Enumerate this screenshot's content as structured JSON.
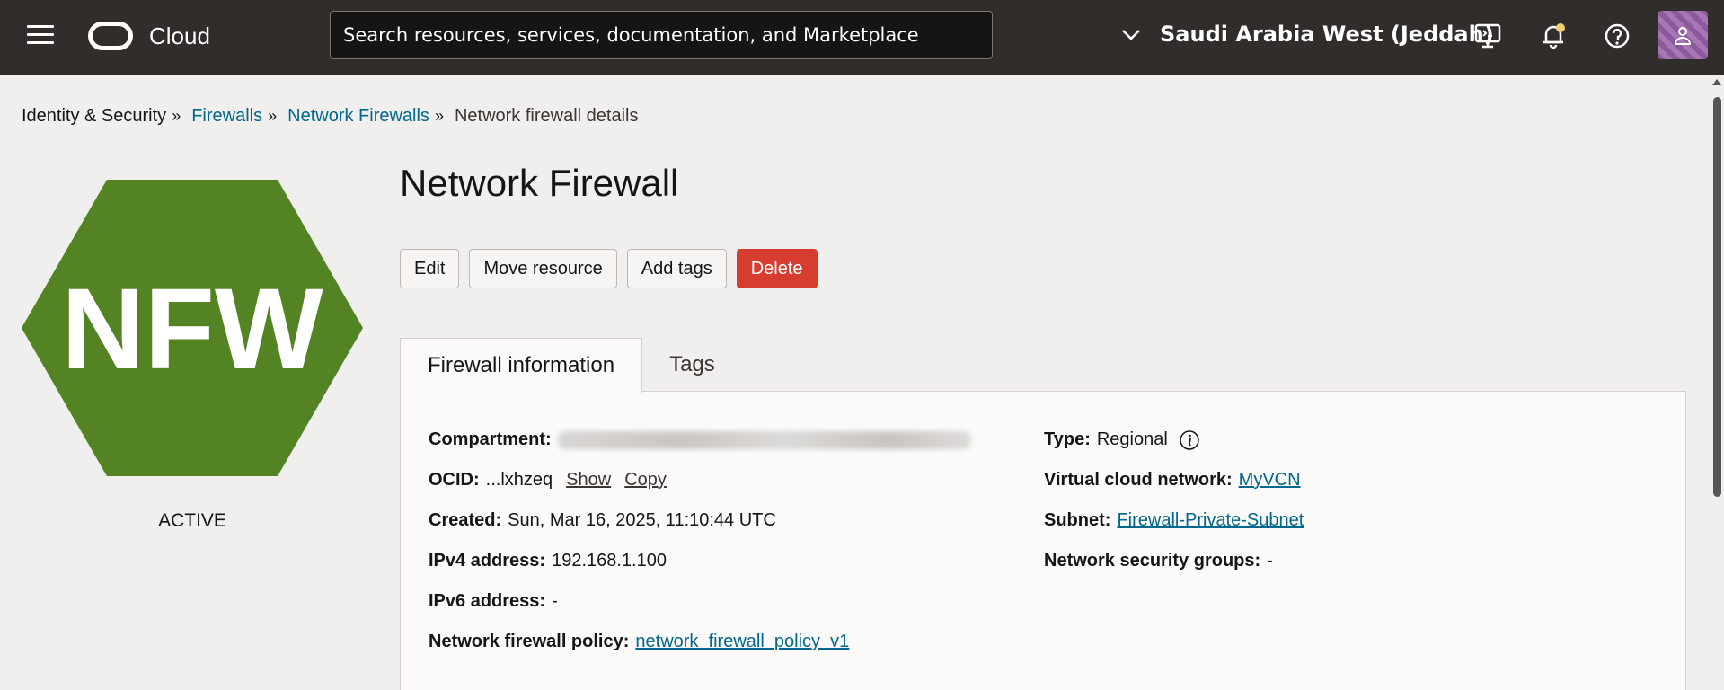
{
  "topbar": {
    "brand": "Cloud",
    "search_placeholder": "Search resources, services, documentation, and Marketplace",
    "region": "Saudi Arabia West (Jeddah)",
    "icons": [
      "menu-icon",
      "oracle-logo-icon",
      "chevron-down-icon",
      "cloud-shell-icon",
      "bell-icon",
      "help-icon",
      "user-icon"
    ],
    "accent": "#312d2a"
  },
  "breadcrumb": {
    "items": [
      {
        "label": "Identity & Security",
        "link": false
      },
      {
        "label": "Firewalls",
        "link": true
      },
      {
        "label": "Network Firewalls",
        "link": true
      },
      {
        "label": "Network firewall details",
        "link": false
      }
    ],
    "separator": "»"
  },
  "resource": {
    "icon_text": "NFW",
    "icon_color": "#548324",
    "status": "ACTIVE",
    "title": "Network Firewall"
  },
  "actions": {
    "edit": "Edit",
    "move": "Move resource",
    "add_tags": "Add tags",
    "delete": "Delete",
    "danger_color": "#d73d2f"
  },
  "tabs": {
    "info": "Firewall information",
    "tags": "Tags"
  },
  "details": {
    "compartment": {
      "label": "Compartment:"
    },
    "ocid": {
      "label": "OCID:",
      "value": "...lxhzeq",
      "show": "Show",
      "copy": "Copy"
    },
    "created": {
      "label": "Created:",
      "value": "Sun, Mar 16, 2025, 11:10:44 UTC"
    },
    "ipv4": {
      "label": "IPv4 address:",
      "value": "192.168.1.100"
    },
    "ipv6": {
      "label": "IPv6 address:",
      "value": "-"
    },
    "policy": {
      "label": "Network firewall policy:",
      "value": "network_firewall_policy_v1"
    },
    "type": {
      "label": "Type:",
      "value": "Regional"
    },
    "vcn": {
      "label": "Virtual cloud network:",
      "value": "MyVCN"
    },
    "subnet": {
      "label": "Subnet:",
      "value": "Firewall-Private-Subnet"
    },
    "nsg": {
      "label": "Network security groups:",
      "value": "-"
    },
    "link_color": "#00688c"
  }
}
